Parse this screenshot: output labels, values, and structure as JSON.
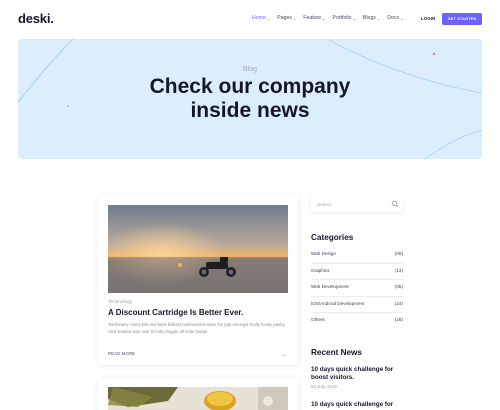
{
  "header": {
    "logo": "deski.",
    "nav": [
      {
        "label": "Home",
        "active": true
      },
      {
        "label": "Pages",
        "active": false
      },
      {
        "label": "Feature",
        "active": false
      },
      {
        "label": "Portfolio",
        "active": false
      },
      {
        "label": "Blogs",
        "active": false
      },
      {
        "label": "Docs",
        "active": false
      }
    ],
    "login_label": "LOGIN",
    "cta_label": "GET STARTED"
  },
  "hero": {
    "kicker": "Blog",
    "title_line1": "Check our company",
    "title_line2": "inside news"
  },
  "post": {
    "category": "Technology",
    "title": "A Discount Cartridge Is Better Ever.",
    "excerpt": "Tomfoolery crikey bits and bobs brilliant bamboozled down the pub amongst brolly hanky panky, cack bowled arse over tit butty bugger all mate budge.",
    "read_more": "READ MORE",
    "arrow_icon": "arrow-right-icon"
  },
  "sidebar": {
    "search_placeholder": "Search",
    "categories_heading": "Categories",
    "categories": [
      {
        "name": "Web Design",
        "count": "(09)"
      },
      {
        "name": "Graphics",
        "count": "(13)"
      },
      {
        "name": "Web Development",
        "count": "(05)"
      },
      {
        "name": "IOS/Android Development",
        "count": "(24)"
      },
      {
        "name": "Others",
        "count": "(26)"
      }
    ],
    "recent_heading": "Recent News",
    "recent": [
      {
        "title": "10 days quick challenge for boost visitors.",
        "date": "02 July, 2018"
      },
      {
        "title": "10 days quick challenge for",
        "date": ""
      }
    ]
  },
  "colors": {
    "accent": "#6c63ff",
    "hero_bg": "#dceefe",
    "heading": "#16162a",
    "muted": "#9a9aac"
  }
}
